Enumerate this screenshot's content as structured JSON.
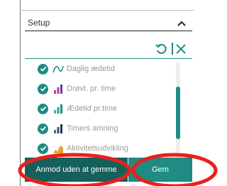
{
  "header": {
    "title": "Setup",
    "collapse_icon": "chevron-up-icon"
  },
  "toolbar": {
    "undo_icon": "undo-icon",
    "close_icon": "close-icon"
  },
  "items": [
    {
      "label": "Daglig ædetid",
      "icon": "line-chart-icon",
      "checked": true
    },
    {
      "label": "Drøvt. pr. time",
      "icon": "bar-chart-icon",
      "checked": true
    },
    {
      "label": "Ædetid pr.time",
      "icon": "bar-chart-icon",
      "checked": true
    },
    {
      "label": "Timers amning",
      "icon": "bar-chart-icon",
      "checked": true
    },
    {
      "label": "Aktivitetsudvikling",
      "icon": "area-chart-icon",
      "checked": true
    }
  ],
  "buttons": {
    "cancel_label": "Anmod uden at gemme",
    "save_label": "Gem"
  },
  "colors": {
    "teal": "#1f8b82",
    "dark_teal": "#16605b",
    "annotation_red": "#e8201c",
    "bar_purple": "#6a3d9a",
    "bar_pink": "#d63a86",
    "area_orange": "#f0a030"
  }
}
